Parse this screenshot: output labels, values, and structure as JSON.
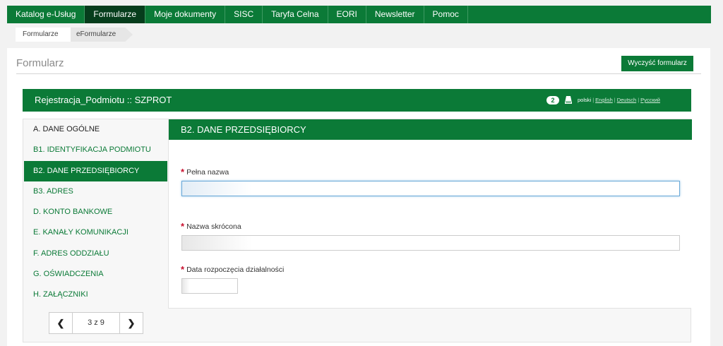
{
  "nav": {
    "items": [
      {
        "label": "Katalog e-Usług"
      },
      {
        "label": "Formularze"
      },
      {
        "label": "Moje dokumenty"
      },
      {
        "label": "SISC"
      },
      {
        "label": "Taryfa Celna"
      },
      {
        "label": "EORI"
      },
      {
        "label": "Newsletter"
      },
      {
        "label": "Pomoc"
      }
    ],
    "active_index": 1
  },
  "breadcrumb": [
    "Formularze",
    "eFormularze"
  ],
  "page": {
    "title": "Formularz",
    "clear_button": "Wyczyść formularz"
  },
  "form": {
    "title": "Rejestracja_Podmiotu :: SZPROT",
    "counter": "2",
    "languages": [
      "polski",
      "English",
      "Deutsch",
      "Русский"
    ],
    "current_language": "polski"
  },
  "sidebar": {
    "items": [
      {
        "label": "A. DANE OGÓLNE"
      },
      {
        "label": "B1. IDENTYFIKACJA PODMIOTU"
      },
      {
        "label": "B2. DANE PRZEDSIĘBIORCY"
      },
      {
        "label": "B3. ADRES"
      },
      {
        "label": "D. KONTO BANKOWE"
      },
      {
        "label": "E. KANAŁY KOMUNIKACJI"
      },
      {
        "label": "F. ADRES ODDZIAŁU"
      },
      {
        "label": "G. OŚWIADCZENIA"
      },
      {
        "label": "H. ZAŁĄCZNIKI"
      }
    ],
    "active_index": 2
  },
  "pager": {
    "label": "3 z 9",
    "prev_icon": "chevron-left-icon",
    "next_icon": "chevron-right-icon"
  },
  "section": {
    "title": "B2. DANE PRZEDSIĘBIORCY",
    "required_marker": "*",
    "fields": {
      "full_name": {
        "label": "Pełna nazwa",
        "value": ""
      },
      "short_name": {
        "label": "Nazwa skrócona",
        "value": ""
      },
      "start_date": {
        "label": "Data rozpoczęcia działalności",
        "value": ""
      }
    }
  },
  "colors": {
    "brand_green": "#0b7a37",
    "dark_green": "#063d1c",
    "required_red": "#c8102e"
  }
}
